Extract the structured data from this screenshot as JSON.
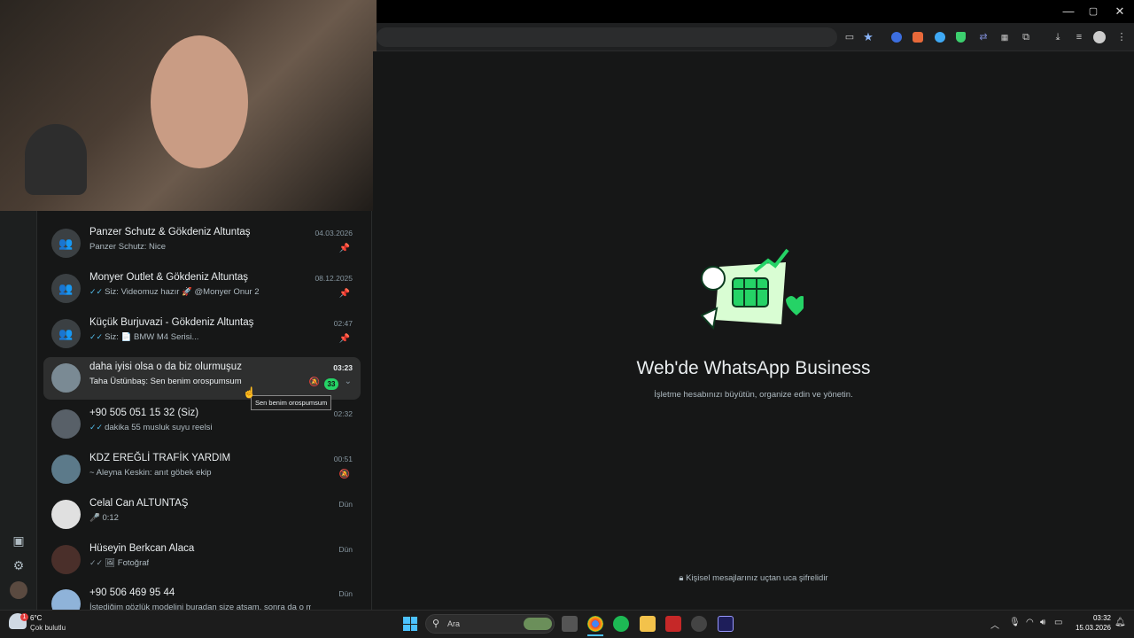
{
  "browser": {
    "window_controls": [
      "—",
      "▢",
      "✕"
    ],
    "toolbar_icons": [
      "cast-icon",
      "star-icon",
      "extension-blue-icon",
      "extension-orange-icon",
      "extension-lightblue-icon",
      "shield-green-icon",
      "link-icon",
      "qr-icon",
      "puzzle-icon",
      "download-icon",
      "media-icon",
      "profile-icon",
      "menu-icon"
    ]
  },
  "chats": [
    {
      "name": "Panzer Schutz & Gökdeniz Altuntaş",
      "preview": "Panzer Schutz: Nice",
      "time": "04.03.2026",
      "type": "group",
      "pinned": true
    },
    {
      "name": "Monyer Outlet & Gökdeniz Altuntaş",
      "preview": "Siz: Videomuz hazır 🚀 @Monyer Onur 2",
      "time": "08.12.2025",
      "type": "group",
      "pinned": true,
      "ticks": true
    },
    {
      "name": "Küçük Burjuvazi - Gökdeniz Altuntaş",
      "preview": "Siz: 📄 BMW M4 Serisi...",
      "time": "02:47",
      "type": "group",
      "pinned": true,
      "ticks": true
    },
    {
      "name": "daha iyisi olsa o da biz olurmuşuz",
      "preview": "Taha Üstünbaş: Sen benim orospumsum",
      "time": "03:23",
      "type": "photo",
      "active": true,
      "unread": "33",
      "muted": true
    },
    {
      "name": "+90 505 051 15 32 (Siz)",
      "preview": "dakika 55 musluk suyu reelsi",
      "time": "02:32",
      "type": "photo",
      "ticks": true
    },
    {
      "name": "KDZ EREĞLİ TRAFİK YARDIM",
      "preview": "~ Aleyna Keskin: anıt göbek ekip",
      "time": "00:51",
      "type": "photo",
      "muted_pin": true
    },
    {
      "name": "Celal Can ALTUNTAŞ",
      "preview": "🎤 0:12",
      "time": "Dün",
      "type": "photo"
    },
    {
      "name": "Hüseyin Berkcan Alaca",
      "preview": "🖼 Fotoğraf",
      "time": "Dün",
      "type": "photo",
      "ticks": true
    },
    {
      "name": "+90 506 469 95 44",
      "preview": "İstediğim gözlük modelini buradan size atsam, sonra da o modele göre...",
      "time": "Dün",
      "type": "photo"
    }
  ],
  "tooltip": "Sen benim orospumsum",
  "intro": {
    "title": "Web'de WhatsApp Business",
    "subtitle": "İşletme hesabınızı büyütün, organize edin ve yönetin.",
    "encryption": "Kişisel mesajlarınız uçtan uca şifrelidir"
  },
  "taskbar": {
    "weather_temp": "6°C",
    "weather_desc": "Çok bulutlu",
    "weather_alert": "1",
    "search_placeholder": "Ara",
    "time": "03:32",
    "date": "15.03.2026"
  },
  "colors": {
    "accent": "#25d366",
    "tick": "#53bdeb",
    "background": "#161717"
  }
}
